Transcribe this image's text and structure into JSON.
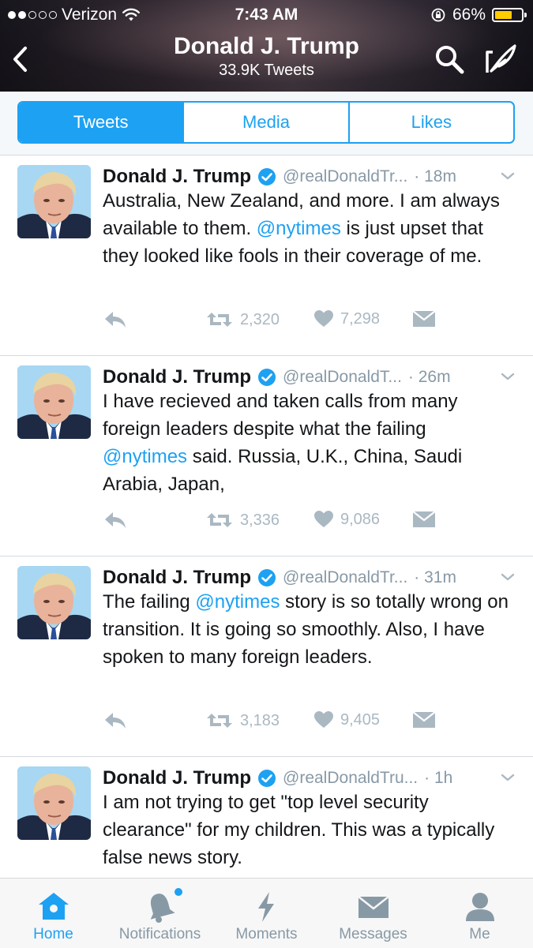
{
  "status_bar": {
    "carrier": "Verizon",
    "signal_bars_filled": 2,
    "signal_bars_total": 5,
    "time": "7:43 AM",
    "battery": "66%",
    "battery_level": 0.66,
    "battery_color": "#ffcc00"
  },
  "nav": {
    "title": "Donald J. Trump",
    "subtitle": "33.9K Tweets",
    "back_icon": "chevron-left-icon",
    "search_icon": "search-icon",
    "compose_icon": "compose-icon"
  },
  "tabs": [
    {
      "label": "Tweets",
      "active": true
    },
    {
      "label": "Media",
      "active": false
    },
    {
      "label": "Likes",
      "active": false
    }
  ],
  "colors": {
    "accent": "#1da1f2",
    "text": "#14171a",
    "muted": "#8899a6",
    "action_gray": "#aab8c2"
  },
  "tweets": [
    {
      "name": "Donald J. Trump",
      "handle": "@realDonaldTr...",
      "time": "· 18m",
      "text_parts": [
        {
          "t": "Australia, New Zealand, and more. I am always available to them. "
        },
        {
          "t": "@nytimes",
          "mention": true
        },
        {
          "t": " is just upset that they looked like fools in their coverage of me."
        }
      ],
      "retweets": "2,320",
      "likes": "7,298"
    },
    {
      "name": "Donald J. Trump",
      "handle": "@realDonaldT...",
      "time": "· 26m",
      "text_parts": [
        {
          "t": "I have recieved and taken calls from many foreign leaders despite what the failing "
        },
        {
          "t": "@nytimes",
          "mention": true
        },
        {
          "t": " said. Russia, U.K., China, Saudi Arabia, Japan,"
        }
      ],
      "retweets": "3,336",
      "likes": "9,086"
    },
    {
      "name": "Donald J. Trump",
      "handle": "@realDonaldTr...",
      "time": "· 31m",
      "text_parts": [
        {
          "t": "The failing "
        },
        {
          "t": "@nytimes",
          "mention": true
        },
        {
          "t": " story is so totally wrong on transition. It is going so smoothly. Also, I have spoken to many foreign leaders."
        }
      ],
      "retweets": "3,183",
      "likes": "9,405"
    },
    {
      "name": "Donald J. Trump",
      "handle": "@realDonaldTru...",
      "time": "· 1h",
      "text_parts": [
        {
          "t": "I am not trying to get \"top level security clearance\" for my children. This was a typically false news story."
        }
      ],
      "retweets": "",
      "likes": ""
    }
  ],
  "tab_bar": [
    {
      "label": "Home",
      "icon": "home-icon",
      "active": true,
      "badge": false
    },
    {
      "label": "Notifications",
      "icon": "bell-icon",
      "active": false,
      "badge": true
    },
    {
      "label": "Moments",
      "icon": "lightning-icon",
      "active": false,
      "badge": false
    },
    {
      "label": "Messages",
      "icon": "envelope-icon",
      "active": false,
      "badge": false
    },
    {
      "label": "Me",
      "icon": "person-icon",
      "active": false,
      "badge": false
    }
  ]
}
